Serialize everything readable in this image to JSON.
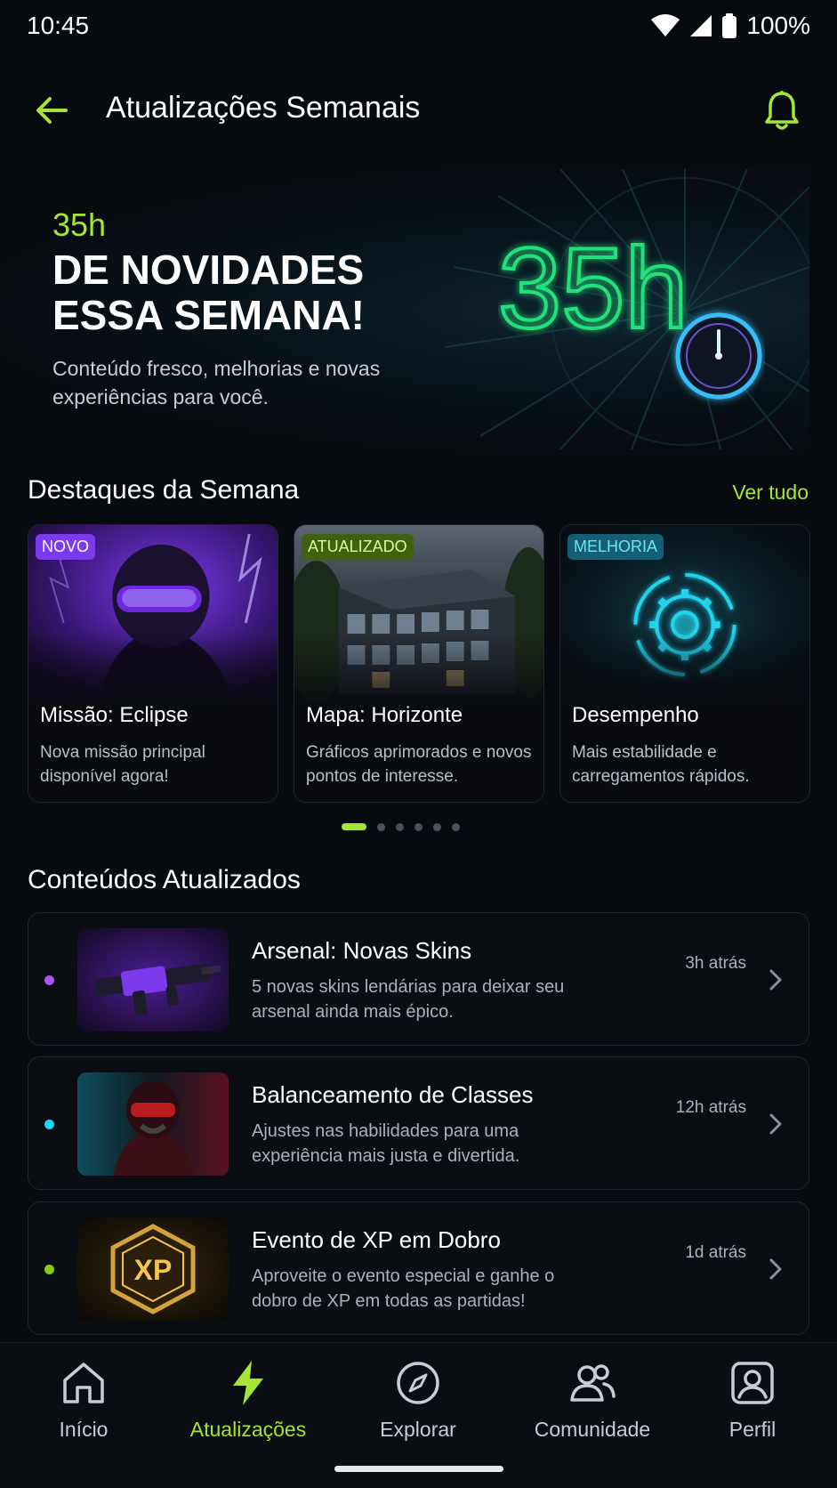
{
  "status_bar": {
    "time": "10:45",
    "battery": "100%",
    "icons": [
      "wifi-icon",
      "signal-icon",
      "battery-icon"
    ]
  },
  "header": {
    "title": "Atualizações Semanais",
    "back_icon": "arrow-left-icon",
    "bell_icon": "bell-icon"
  },
  "hero": {
    "accent": "35h",
    "title_line1": "DE NOVIDADES",
    "title_line2": "ESSA SEMANA!",
    "description": "Conteúdo fresco, melhorias e novas experiências para você.",
    "neon_text": "35h"
  },
  "highlights": {
    "title": "Destaques da Semana",
    "see_all": "Ver tudo",
    "cards": [
      {
        "badge": "NOVO",
        "title": "Missão: Eclipse",
        "description": "Nova missão principal disponível agora!"
      },
      {
        "badge": "ATUALIZADO",
        "title": "Mapa: Horizonte",
        "description": "Gráficos aprimorados e novos pontos de interesse."
      },
      {
        "badge": "MELHORIA",
        "title": "Desempenho",
        "description": "Mais estabilidade e carregamentos rápidos."
      }
    ],
    "pagination": {
      "total": 6,
      "active": 1
    }
  },
  "updated": {
    "title": "Conteúdos Atualizados",
    "items": [
      {
        "title": "Arsenal: Novas Skins",
        "description": "5 novas skins lendárias para deixar seu arsenal ainda mais épico.",
        "time": "3h atrás",
        "dot_color": "#a855f7"
      },
      {
        "title": "Balanceamento de Classes",
        "description": "Ajustes nas habilidades para uma experiência mais justa e divertida.",
        "time": "12h atrás",
        "dot_color": "#22d3ee"
      },
      {
        "title": "Evento de XP em Dobro",
        "description": "Aproveite o evento especial e ganhe o dobro de XP em todas as partidas!",
        "time": "1d atrás",
        "dot_color": "#84cc16",
        "thumb_text": "XP"
      }
    ]
  },
  "bottom_nav": {
    "items": [
      {
        "label": "Início",
        "icon": "home-icon"
      },
      {
        "label": "Atualizações",
        "icon": "lightning-icon",
        "active": true
      },
      {
        "label": "Explorar",
        "icon": "compass-icon"
      },
      {
        "label": "Comunidade",
        "icon": "users-icon"
      },
      {
        "label": "Perfil",
        "icon": "profile-icon"
      }
    ]
  },
  "colors": {
    "accent": "#a3e635",
    "background": "#070a0f",
    "badge_new": "#7c3aed",
    "badge_updated": "#3f6212",
    "badge_improvement": "#155e75"
  }
}
